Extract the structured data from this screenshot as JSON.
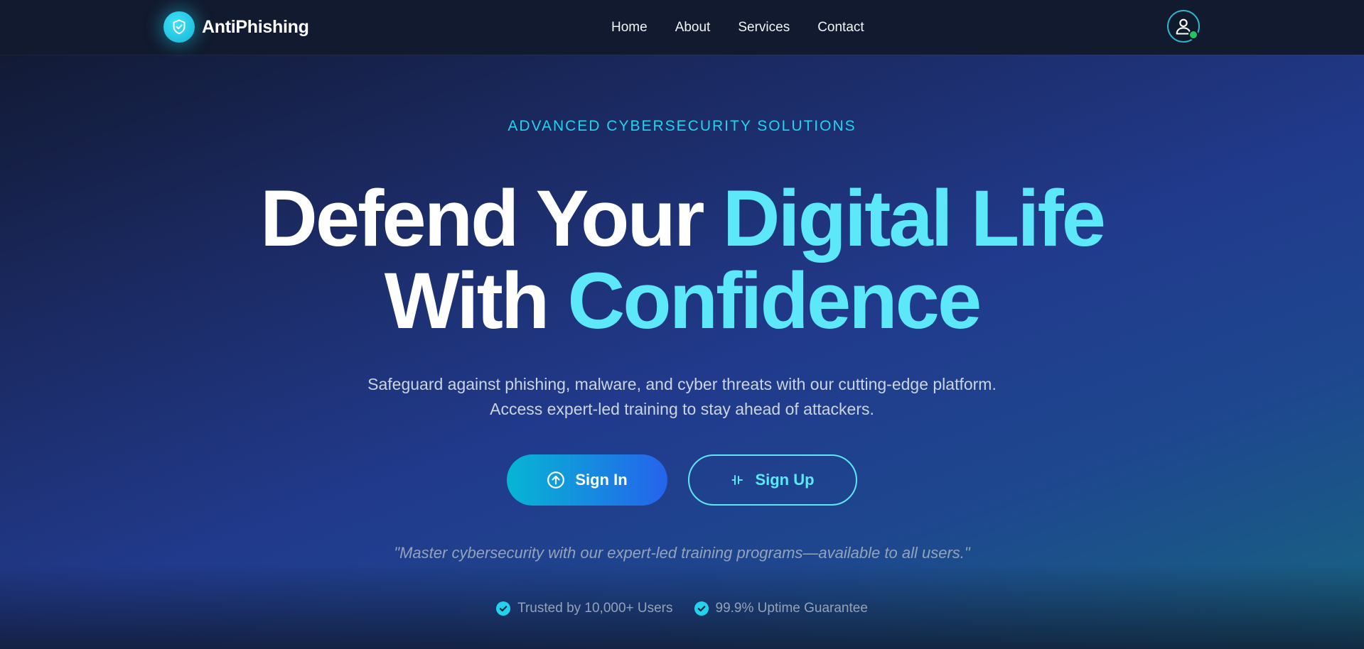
{
  "brand": {
    "name": "AntiPhishing"
  },
  "nav": {
    "links": [
      {
        "label": "Home"
      },
      {
        "label": "About"
      },
      {
        "label": "Services"
      },
      {
        "label": "Contact"
      }
    ]
  },
  "hero": {
    "eyebrow": "ADVANCED CYBERSECURITY SOLUTIONS",
    "headline_part1": "Defend Your",
    "headline_accent1": "Digital Life",
    "headline_part2": "With",
    "headline_accent2": "Confidence",
    "subtitle_line1": "Safeguard against phishing, malware, and cyber threats with our cutting-edge platform.",
    "subtitle_line2": "Access expert-led training to stay ahead of attackers.",
    "signin_label": "Sign In",
    "signup_label": "Sign Up",
    "quote": "\"Master cybersecurity with our expert-led training programs—available to all users.\""
  },
  "badges": [
    {
      "label": "Trusted by 10,000+ Users",
      "icon": "check-circle-icon"
    },
    {
      "label": "99.9% Uptime Guarantee",
      "icon": "check-circle-icon"
    }
  ],
  "colors": {
    "accent": "#22d3ee",
    "headline_accent": "#5ce8f8",
    "navbar_bg": "#111a2e",
    "status_online": "#22c55e"
  }
}
